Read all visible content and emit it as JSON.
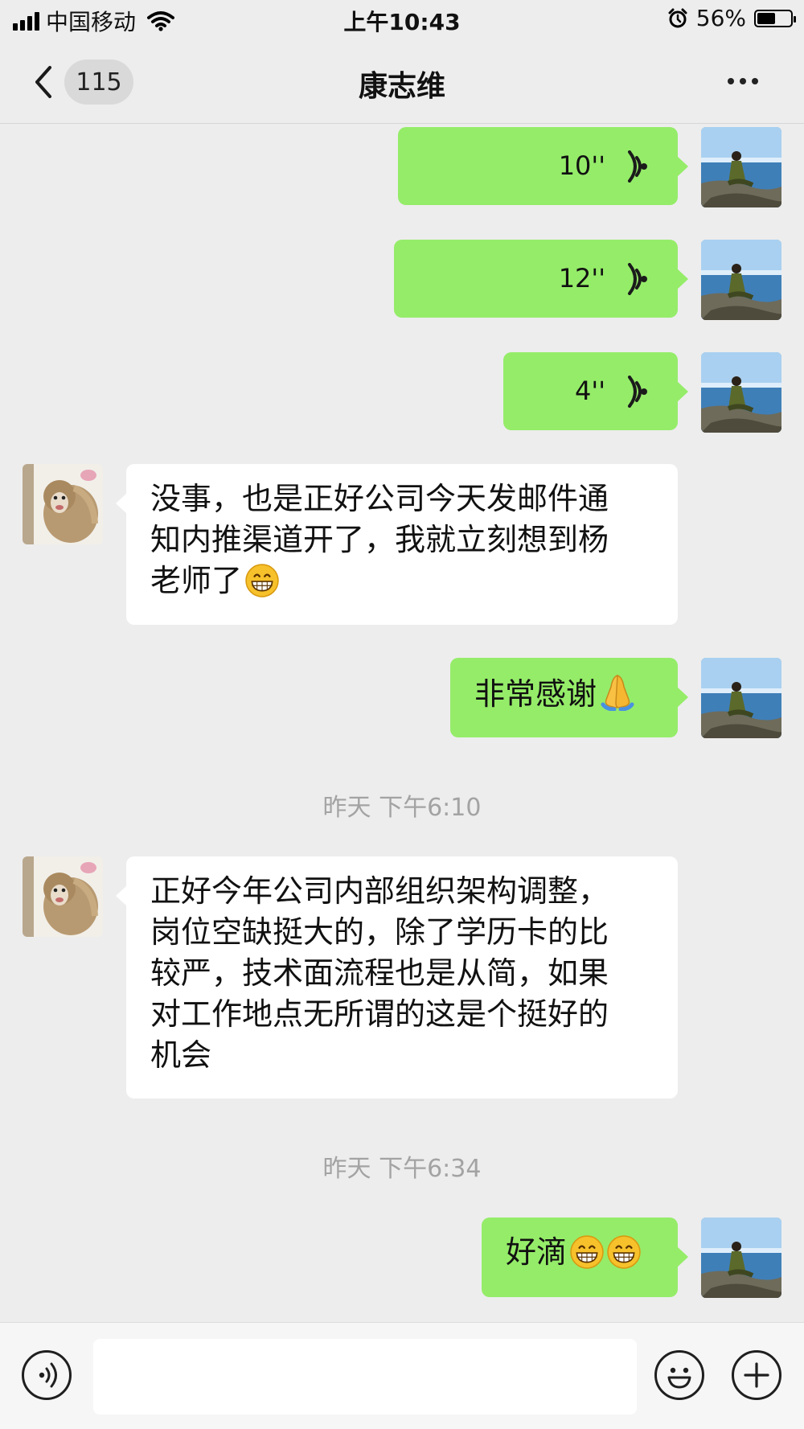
{
  "status_bar": {
    "carrier": "中国移动",
    "time": "上午10:43",
    "battery": "56%",
    "battery_level": 0.56
  },
  "nav": {
    "back_count": "115",
    "title": "康志维"
  },
  "messages": {
    "voice1": {
      "duration": "10''"
    },
    "voice2": {
      "duration": "12''"
    },
    "voice3": {
      "duration": "4''"
    },
    "msg1": {
      "text": "没事，也是正好公司今天发邮件通\n知内推渠道开了，我就立刻想到杨\n老师了"
    },
    "msg2": {
      "text": "非常感谢"
    },
    "timestamp1": "昨天 下午6:10",
    "msg3": {
      "text": "正好今年公司内部组织架构调整，\n岗位空缺挺大的，除了学历卡的比\n较严，技术面流程也是从简，如果\n对工作地点无所谓的这是个挺好的\n机会"
    },
    "timestamp2": "昨天 下午6:34",
    "msg4": {
      "text": "好滴"
    }
  },
  "colors": {
    "sent_bubble": "#95ec69",
    "received_bubble": "#ffffff",
    "background": "#ededed"
  },
  "icons": [
    "signal-icon",
    "wifi-icon",
    "alarm-icon",
    "battery-icon",
    "back-chevron-icon",
    "more-icon",
    "voice-wave-icon",
    "grin-emoji-icon",
    "pray-emoji-icon",
    "voice-input-icon",
    "emoji-icon",
    "plus-icon"
  ]
}
